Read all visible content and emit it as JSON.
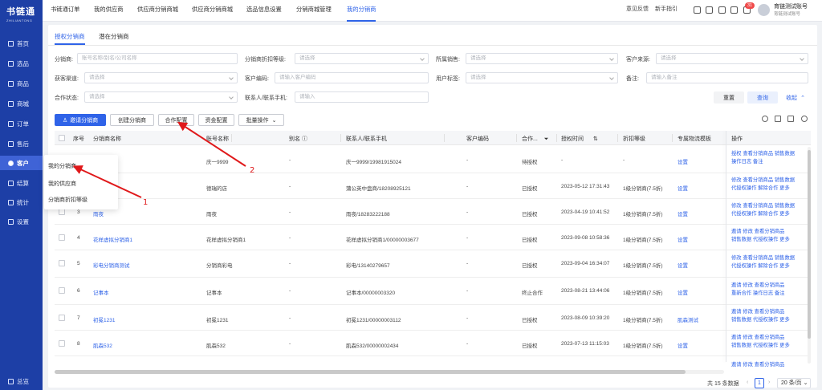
{
  "brand": {
    "name": "书链通",
    "subtitle": "ZHILIANTONG"
  },
  "sidebar": {
    "items": [
      {
        "label": "首页",
        "icon": "home-icon"
      },
      {
        "label": "选品",
        "icon": "goods-icon"
      },
      {
        "label": "商品",
        "icon": "product-icon"
      },
      {
        "label": "商城",
        "icon": "store-icon"
      },
      {
        "label": "订单",
        "icon": "order-icon"
      },
      {
        "label": "售后",
        "icon": "aftersale-icon"
      },
      {
        "label": "客户",
        "icon": "customer-icon",
        "active": true
      },
      {
        "label": "结算",
        "icon": "settle-icon"
      },
      {
        "label": "统计",
        "icon": "stats-icon"
      },
      {
        "label": "设置",
        "icon": "settings-icon"
      }
    ],
    "bottom": {
      "label": "总览",
      "icon": "menu-icon"
    }
  },
  "topnav": {
    "tabs": [
      "书链通订单",
      "我的供应商",
      "供应商分销商城",
      "供应商分销商城",
      "选品信息设置",
      "分销商城管理",
      "我的分销商"
    ],
    "active_index": 6,
    "right": {
      "feedback": "意见反馈",
      "guide": "新手指引",
      "notice_count": "31",
      "account_name": "育链测试账号",
      "account_sub": "育链测试账号"
    }
  },
  "subtabs": [
    "授权分销商",
    "潜在分销商"
  ],
  "filters": {
    "row1": [
      {
        "label": "分销商:",
        "placeholder": "账号名称/别名/公司名称"
      },
      {
        "label": "分销商折扣等级:",
        "placeholder": "请选择"
      },
      {
        "label": "所属销售:",
        "placeholder": "请选择"
      },
      {
        "label": "客户来源:",
        "placeholder": "请选择"
      }
    ],
    "row2": [
      {
        "label": "获客渠道:",
        "placeholder": "请选择"
      },
      {
        "label": "客户编码:",
        "placeholder": "请输入客户编码"
      },
      {
        "label": "用户标签:",
        "placeholder": "请选择"
      },
      {
        "label": "备注:",
        "placeholder": "请输入备注"
      }
    ],
    "row3": [
      {
        "label": "合作状态:",
        "placeholder": "请选择"
      },
      {
        "label": "联系人/联系手机:",
        "placeholder": "请输入"
      }
    ],
    "reset": "重置",
    "query": "查询",
    "collapse": "收起"
  },
  "actions": {
    "invite": "邀请分销商",
    "create": "创建分销商",
    "coop": "合作配置",
    "fund": "资金配置",
    "batch": "批量操作"
  },
  "table": {
    "headers": [
      "序号",
      "分销商名称",
      "账号名称",
      "别名",
      "联系人/联系手机",
      "客户编码",
      "合作...",
      "授权时间",
      "折扣等级",
      "专属物流模板",
      "操作"
    ],
    "rows": [
      {
        "idx": "",
        "name": "",
        "account": "庆一9999",
        "alias": "-",
        "contact": "庆一9999/19981915024",
        "code": "-",
        "status": "待授权",
        "time": "-",
        "level": "-",
        "tpl": "设置",
        "ops": [
          "授权  查看分销商品  销售数据",
          "操作日志  备注"
        ]
      },
      {
        "idx": "",
        "name": "",
        "account": "德瑞的店",
        "alias": "-",
        "contact": "蒲公英中盘商/18208925121",
        "code": "-",
        "status": "已授权",
        "time": "2023-05-12 17:31:43",
        "level": "1级分销商(7.5折)",
        "tpl": "设置",
        "ops": [
          "修改  查看分销商品  销售数据",
          "代授权操作  解除合作  更多"
        ]
      },
      {
        "idx": "3",
        "name": "雨夜",
        "account": "雨夜",
        "alias": "-",
        "contact": "雨夜/18283222188",
        "code": "-",
        "status": "已授权",
        "time": "2023-04-19 10:41:52",
        "level": "1级分销商(7.5折)",
        "tpl": "设置",
        "ops": [
          "修改  查看分销商品  销售数据",
          "代授权操作  解除合作  更多"
        ]
      },
      {
        "idx": "4",
        "name": "花样虚拟分销商1",
        "account": "花样虚拟分销商1",
        "alias": "-",
        "contact": "花样虚拟分销商1/00000003677",
        "code": "-",
        "status": "已授权",
        "time": "2023-09-08 10:58:36",
        "level": "1级分销商(7.5折)",
        "tpl": "设置",
        "ops": [
          "邀请  修改  查看分销商品",
          "销售数据  代授权操作  更多"
        ]
      },
      {
        "idx": "5",
        "name": "彩电分销商测试",
        "account": "分销商彩电",
        "alias": "-",
        "contact": "彩电/13140279657",
        "code": "-",
        "status": "已授权",
        "time": "2023-09-04 16:34:07",
        "level": "1级分销商(7.5折)",
        "tpl": "设置",
        "ops": [
          "修改  查看分销商品  销售数据",
          "代授权操作  解除合作  更多"
        ]
      },
      {
        "idx": "6",
        "name": "记事本",
        "account": "记事本",
        "alias": "-",
        "contact": "记事本/00000003320",
        "code": "-",
        "status": "终止合作",
        "time": "2023-08-21 13:44:06",
        "level": "1级分销商(7.5折)",
        "tpl": "设置",
        "ops": [
          "邀请  修改  查看分销商品",
          "重新合作  操作日志  备注"
        ]
      },
      {
        "idx": "7",
        "name": "初冕1231",
        "account": "初冕1231",
        "alias": "-",
        "contact": "初冕1231/00000003112",
        "code": "-",
        "status": "已授权",
        "time": "2023-08-09 10:39:20",
        "level": "1级分销商(7.5折)",
        "tpl": "肌森测试",
        "ops": [
          "邀请  修改  查看分销商品",
          "销售数据  代授权操作  更多"
        ]
      },
      {
        "idx": "8",
        "name": "肌森532",
        "account": "肌森532",
        "alias": "-",
        "contact": "肌森532/00000002434",
        "code": "-",
        "status": "已授权",
        "time": "2023-07-13 11:15:03",
        "level": "1级分销商(7.5折)",
        "tpl": "设置",
        "ops": [
          "邀请  修改  查看分销商品",
          "销售数据  代授权操作  更多"
        ]
      },
      {
        "idx": "",
        "name": "",
        "account": "",
        "alias": "",
        "contact": "",
        "code": "",
        "status": "",
        "time": "",
        "level": "",
        "tpl": "",
        "ops": [
          "邀请  修改  查看分销商品",
          ""
        ]
      }
    ]
  },
  "pagination": {
    "total": "共 15 条数据",
    "page": "1",
    "size": "20 条/页"
  },
  "popup_menu": [
    "我的分销商",
    "我的供应商",
    "分销商折扣等级"
  ],
  "annotations": [
    "1",
    "2"
  ]
}
